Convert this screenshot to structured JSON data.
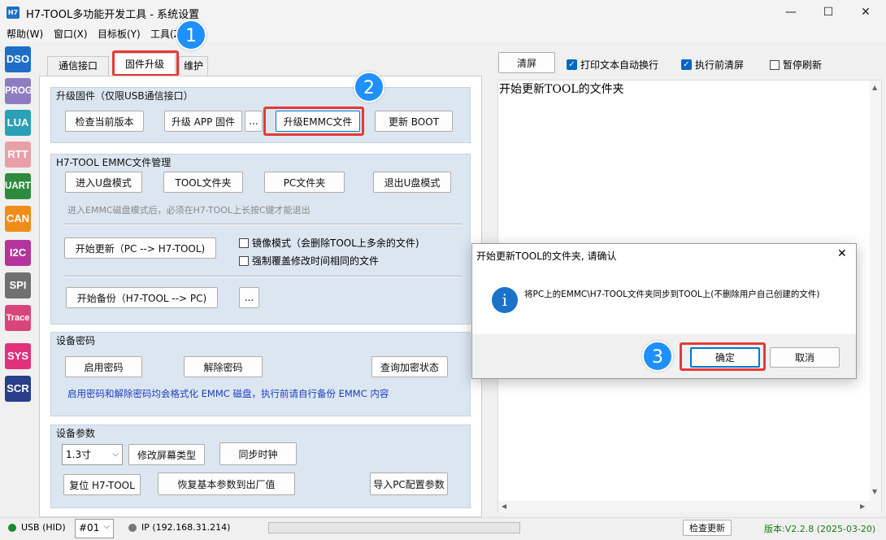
{
  "window": {
    "logo": "H7",
    "title": "H7-TOOL多功能开发工具 - 系统设置",
    "btn_min": "—",
    "btn_max": "☐",
    "btn_close": "✕"
  },
  "menu": [
    "帮助(W)",
    "窗口(X)",
    "目标板(Y)",
    "工具(Z)"
  ],
  "sidebar": [
    {
      "label": "DSO",
      "color": "#1e6ec8"
    },
    {
      "label": "PROG",
      "color": "#8e7cc3"
    },
    {
      "label": "LUA",
      "color": "#2aa1b6"
    },
    {
      "label": "RTT",
      "color": "#e8a0a8"
    },
    {
      "label": "UART",
      "color": "#2e8b3e"
    },
    {
      "label": "CAN",
      "color": "#f08c1a"
    },
    {
      "label": "I2C",
      "color": "#b4349c"
    },
    {
      "label": "SPI",
      "color": "#707070"
    },
    {
      "label": "Trace",
      "color": "#d8457a"
    },
    {
      "label": "SYS",
      "color": "#e0327a"
    },
    {
      "label": "SCR",
      "color": "#2a3e8c"
    }
  ],
  "tabs": [
    "通信接口",
    "固件升级",
    "维护"
  ],
  "badges": [
    "1",
    "2",
    "3"
  ],
  "upgrade": {
    "title": "升级固件（仅限USB通信接口）",
    "check_version": "检查当前版本",
    "upgrade_app": "升级 APP 固件",
    "dots": "...",
    "upgrade_emmc": "升级EMMC文件",
    "update_boot": "更新 BOOT"
  },
  "emmc": {
    "title": "H7-TOOL EMMC文件管理",
    "enter_udisk": "进入U盘模式",
    "tool_folder": "TOOL文件夹",
    "pc_folder": "PC文件夹",
    "exit_udisk": "退出U盘模式",
    "hint": "进入EMMC磁盘模式后，必须在H7-TOOL上长按C键才能退出",
    "start_update": "开始更新（PC --> H7-TOOL)",
    "mirror_mode": "镜像模式（会删除TOOL上多余的文件)",
    "force_overwrite": "强制覆盖修改时间相同的文件",
    "start_backup": "开始备份（H7-TOOL --> PC)",
    "dots": "..."
  },
  "password": {
    "title": "设备密码",
    "enable": "启用密码",
    "disable": "解除密码",
    "query": "查询加密状态",
    "warning": "启用密码和解除密码均会格式化 EMMC 磁盘，执行前请自行备份 EMMC 内容"
  },
  "params": {
    "title": "设备参数",
    "screen_size": "1.3寸",
    "change_screen": "修改屏幕类型",
    "sync_clock": "同步时钟",
    "reset": "复位 H7-TOOL",
    "restore": "恢复基本参数到出厂值",
    "import": "导入PC配置参数"
  },
  "log": {
    "clear": "清屏",
    "auto_wrap": "打印文本自动换行",
    "auto_wrap_checked": true,
    "clear_before": "执行前清屏",
    "clear_before_checked": true,
    "pause": "暂停刷新",
    "pause_checked": false,
    "text": "开始更新TOOL的文件夹"
  },
  "dialog": {
    "title": "开始更新TOOL的文件夹, 请确认",
    "icon": "i",
    "message": "将PC上的EMMC\\H7-TOOL文件夹同步到TOOL上(不删除用户自己创建的文件)",
    "ok": "确定",
    "cancel": "取消",
    "close": "✕"
  },
  "status": {
    "usb": "USB (HID)",
    "device": "#01",
    "ip": "IP (192.168.31.214)",
    "check_update": "检查更新",
    "version": "版本:V2.2.8 (2025-03-20)"
  }
}
